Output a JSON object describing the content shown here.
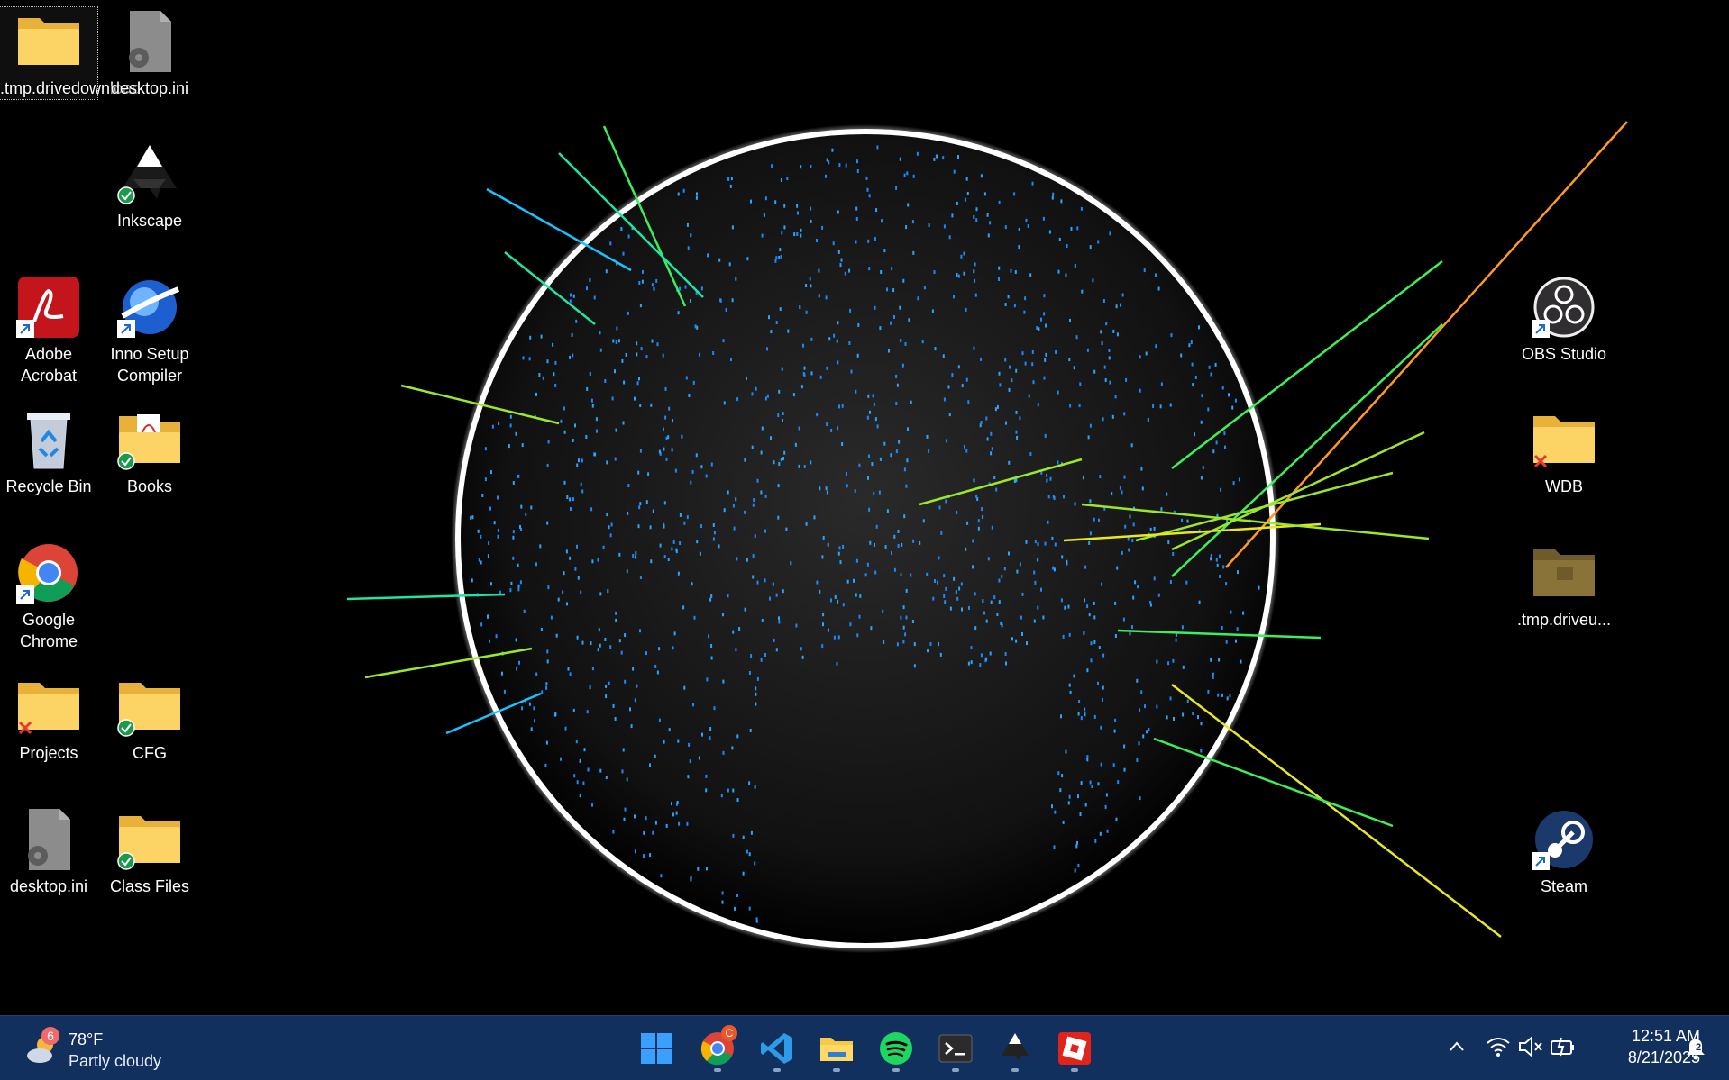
{
  "desktop": {
    "left_icons": [
      {
        "label": ".tmp.drivedownload",
        "icon": "folder-icon",
        "badge": "",
        "selected": true
      },
      {
        "label": "desktop.ini",
        "icon": "settings-file-icon",
        "badge": ""
      },
      {
        "label": "Inkscape",
        "icon": "inkscape-icon",
        "badge": "synced"
      },
      {
        "label": "Adobe Acrobat",
        "icon": "acrobat-icon",
        "badge": "shortcut"
      },
      {
        "label": "Inno Setup Compiler",
        "icon": "inno-setup-icon",
        "badge": "shortcut"
      },
      {
        "label": "Recycle Bin",
        "icon": "recycle-bin-icon",
        "badge": ""
      },
      {
        "label": "Books",
        "icon": "folder-pdf-icon",
        "badge": "synced"
      },
      {
        "label": "Google Chrome",
        "icon": "chrome-icon",
        "badge": "shortcut"
      },
      {
        "label": "Projects",
        "icon": "folder-icon",
        "badge": "error"
      },
      {
        "label": "CFG",
        "icon": "folder-icon",
        "badge": "synced"
      },
      {
        "label": "desktop.ini",
        "icon": "settings-file-icon",
        "badge": ""
      },
      {
        "label": "Class Files",
        "icon": "folder-icon",
        "badge": "synced"
      }
    ],
    "right_icons": [
      {
        "label": "OBS Studio",
        "icon": "obs-icon",
        "badge": "shortcut"
      },
      {
        "label": "WDB",
        "icon": "folder-icon",
        "badge": "error"
      },
      {
        "label": ".tmp.driveu...",
        "icon": "folder-dim-icon",
        "badge": ""
      },
      {
        "label": "Steam",
        "icon": "steam-icon",
        "badge": "shortcut"
      }
    ]
  },
  "taskbar": {
    "weather": {
      "temp": "78°F",
      "condition": "Partly cloudy",
      "alert_count": "6",
      "icon": "partly-cloudy-icon"
    },
    "apps": [
      {
        "name": "start",
        "icon": "windows-start-icon"
      },
      {
        "name": "chrome",
        "icon": "chrome-icon",
        "badge": "C"
      },
      {
        "name": "vscode",
        "icon": "vscode-icon"
      },
      {
        "name": "file-explorer",
        "icon": "file-explorer-icon"
      },
      {
        "name": "spotify",
        "icon": "spotify-icon"
      },
      {
        "name": "terminal",
        "icon": "terminal-icon"
      },
      {
        "name": "inkscape",
        "icon": "inkscape-icon"
      },
      {
        "name": "roblox-studio",
        "icon": "roblox-studio-icon"
      }
    ],
    "tray": {
      "icons": [
        "chevron-up-icon",
        "wifi-icon",
        "speaker-muted-icon",
        "battery-icon"
      ],
      "time": "12:51 AM",
      "date": "8/21/2025",
      "notification_count": "2"
    }
  },
  "colors": {
    "taskbar": "#12305e",
    "accent_blue": "#1e88ff",
    "folder": "#f7cf5b"
  }
}
